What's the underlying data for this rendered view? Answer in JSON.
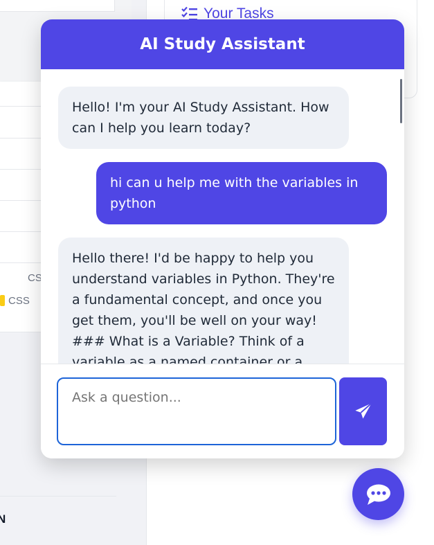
{
  "background": {
    "tasks_title": "Your Tasks",
    "tag_code": "CS",
    "tag_label": "CSS",
    "bottom_letter": "N"
  },
  "chat": {
    "title": "AI Study Assistant",
    "messages": [
      {
        "role": "assistant",
        "text": "Hello! I'm your AI Study Assistant. How can I help you learn today?"
      },
      {
        "role": "user",
        "text": "hi can u help me with the variables in python"
      },
      {
        "role": "assistant",
        "text": "Hello there! I'd be happy to help you understand variables in Python. They're a fundamental concept, and once you get them, you'll be well on your way! ### What is a Variable? Think of a variable as a named container or a label for a piece of"
      }
    ],
    "input": {
      "placeholder": "Ask a question...",
      "value": ""
    },
    "send_icon": "paper-plane-icon"
  },
  "fab": {
    "icon": "chat-bubble-icon"
  },
  "colors": {
    "accent": "#4f46e5",
    "bot_bubble": "#eef1f6",
    "input_border": "#1d64d8"
  }
}
